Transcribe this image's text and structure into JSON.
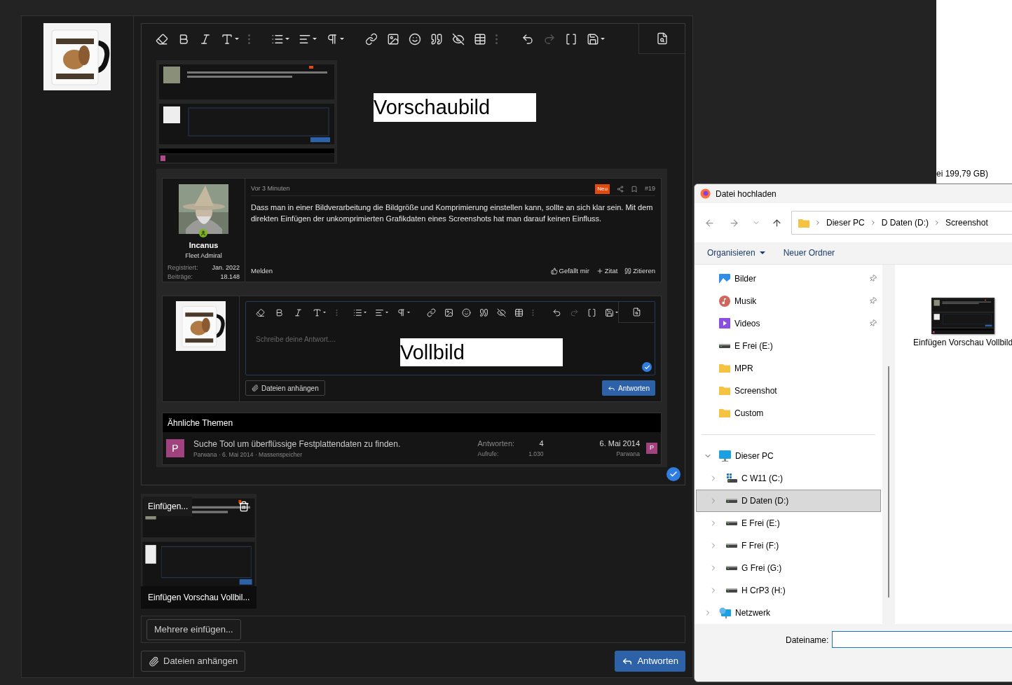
{
  "background_window": {
    "text": "ei 199,79 GB)"
  },
  "editor": {
    "pasted_screenshot": {
      "annotation_top": "Vorschaubild",
      "post": {
        "time": "Vor 3 Minuten",
        "badge": "Neu",
        "number": "#19",
        "author": "Incanus",
        "rank": "Fleet Admiral",
        "stats": [
          {
            "label": "Registriert:",
            "value": "Jan. 2022"
          },
          {
            "label": "Beiträge:",
            "value": "18.148"
          }
        ],
        "text": "Dass man in einer Bildverarbeitung die Bildgröße und Komprimierung einstellen kann, sollte an sich klar sein. Mit dem direkten Einfügen der unkomprimierten Grafikdaten eines Screenshots hat man darauf keinen Einfluss.",
        "report": "Melden",
        "actions": [
          {
            "label": "Gefällt mir",
            "kind": "like"
          },
          {
            "label": "Zitat",
            "kind": "add"
          },
          {
            "label": "Zitieren",
            "kind": "quote"
          }
        ]
      },
      "reply": {
        "placeholder": "Schreibe deine Antwort....",
        "annotation": "Vollbild",
        "attach": "Dateien anhängen",
        "submit": "Antworten"
      },
      "related": {
        "title": "Ähnliche Themen",
        "items": [
          {
            "avatar": "P",
            "title": "Suche Tool um überflüssige Festplattendaten zu finden.",
            "meta": "Parwana · 6. Mai 2014 · Massenspeicher",
            "stats": [
              {
                "label": "Antworten:",
                "value": "4"
              },
              {
                "label": "Aufrufe:",
                "value": "1.030"
              }
            ],
            "date": "6. Mai 2014",
            "user": "Parwana",
            "user_avatar": "P"
          }
        ]
      }
    }
  },
  "attachment": {
    "insert_button": "Einfügen...",
    "caption": "Einfügen Vorschau Vollbil..."
  },
  "insert_multiple": "Mehrere einfügen...",
  "footer": {
    "attach": "Dateien anhängen",
    "submit": "Antworten"
  },
  "dialog": {
    "title": "Datei hochladen",
    "breadcrumb": [
      "Dieser PC",
      "D Daten (D:)",
      "Screenshot"
    ],
    "toolbar": [
      {
        "label": "Organisieren",
        "dropdown": true
      },
      {
        "label": "Neuer Ordner",
        "dropdown": false
      }
    ],
    "quick_access": [
      {
        "label": "Bilder",
        "kind": "pictures",
        "pinned": true
      },
      {
        "label": "Musik",
        "kind": "music",
        "pinned": true
      },
      {
        "label": "Videos",
        "kind": "videos",
        "pinned": true
      },
      {
        "label": "E Frei (E:)",
        "kind": "drive",
        "pinned": false
      },
      {
        "label": "MPR",
        "kind": "folder",
        "pinned": false
      },
      {
        "label": "Screenshot",
        "kind": "folder",
        "pinned": false
      },
      {
        "label": "Custom",
        "kind": "folder",
        "pinned": false
      }
    ],
    "tree": [
      {
        "label": "Dieser PC",
        "kind": "pc",
        "expanded": true,
        "selected": false,
        "children": [
          {
            "label": "C W11 (C:)",
            "kind": "system_drive",
            "expanded": false,
            "selected": false
          },
          {
            "label": "D Daten (D:)",
            "kind": "drive",
            "expanded": false,
            "selected": true
          },
          {
            "label": "E Frei (E:)",
            "kind": "drive",
            "expanded": false,
            "selected": false
          },
          {
            "label": "F Frei (F:)",
            "kind": "drive",
            "expanded": false,
            "selected": false
          },
          {
            "label": "G Frei (G:)",
            "kind": "drive",
            "expanded": false,
            "selected": false
          },
          {
            "label": "H CrP3 (H:)",
            "kind": "drive",
            "expanded": false,
            "selected": false
          }
        ]
      },
      {
        "label": "Netzwerk",
        "kind": "network",
        "expanded": false,
        "selected": false
      }
    ],
    "files": [
      {
        "name": "Einfügen Vorschau Vollbild"
      }
    ],
    "filename_label": "Dateiname:"
  }
}
